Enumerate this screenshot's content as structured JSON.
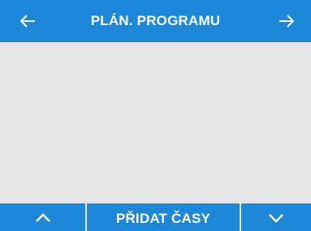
{
  "header": {
    "title": "PLÁN. PROGRAMU",
    "back_icon": "arrow-left-icon",
    "forward_icon": "arrow-right-icon"
  },
  "footer": {
    "up_icon": "chevron-up-icon",
    "add_times_label": "PŘIDAT ČASY",
    "down_icon": "chevron-down-icon"
  },
  "colors": {
    "accent": "#1e88d8",
    "background": "#e5e5e5",
    "text_on_accent": "#ffffff"
  }
}
